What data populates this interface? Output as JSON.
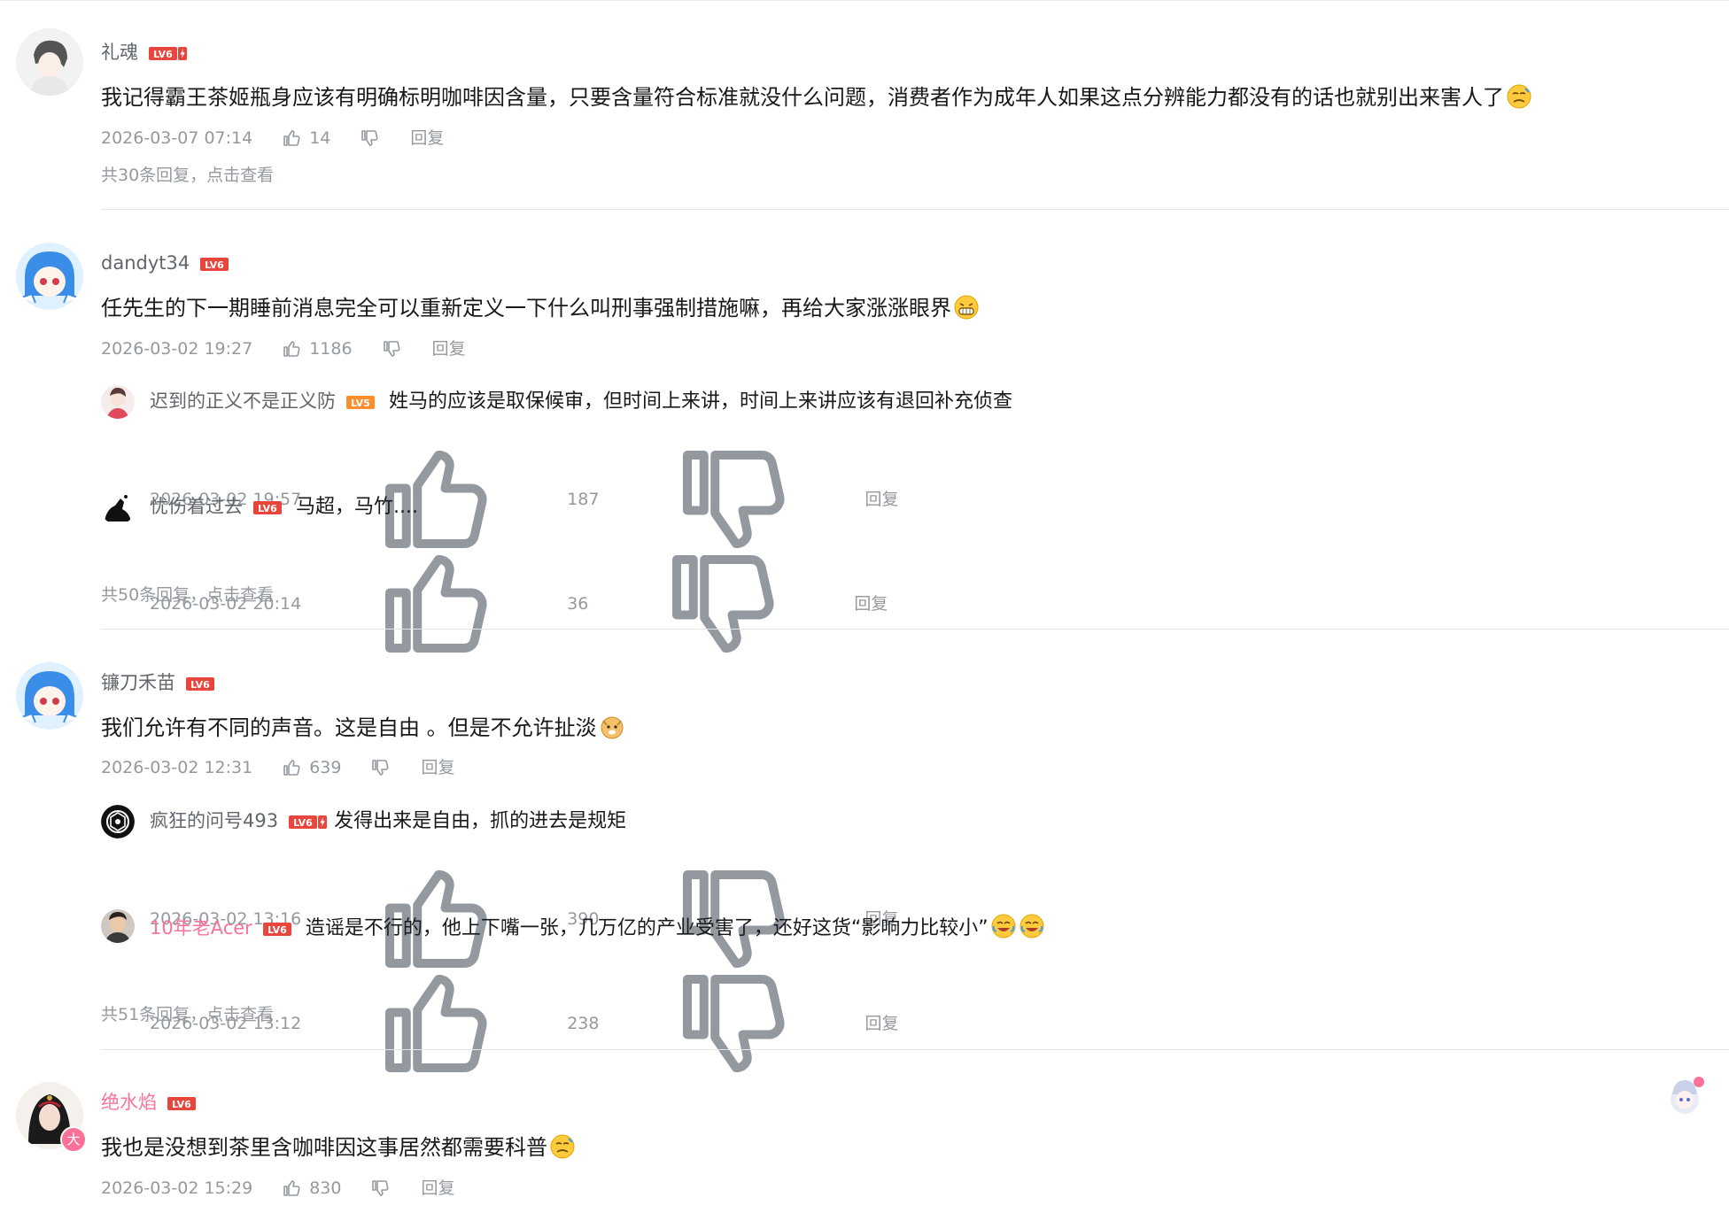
{
  "ui": {
    "colors": {
      "text": "#18191c",
      "secondary": "#61666d",
      "meta": "#9499a0",
      "vip_pink": "#fb7299",
      "level_red": "#e8453c",
      "divider": "#e3e5e7"
    },
    "icons": [
      "thumb-up-icon",
      "thumb-down-icon",
      "level-badge-icon",
      "emoji-icon"
    ]
  },
  "comments": [
    {
      "user": "礼魂",
      "level": "LV6",
      "text": "我记得霸王茶姬瓶身应该有明确标明咖啡因含量，只要含量符合标准就没什么问题，消费者作为成年人如果这点分辨能力都没有的话也就别出来害人了",
      "time": "2026-03-07 07:14",
      "likes": "14",
      "reply_label": "回复",
      "more": "共30条回复，点击查看"
    },
    {
      "user": "dandyt34",
      "level": "LV6",
      "text": "任先生的下一期睡前消息完全可以重新定义一下什么叫刑事强制措施嘛，再给大家涨涨眼界",
      "time": "2026-03-02 19:27",
      "likes": "1186",
      "reply_label": "回复",
      "replies": [
        {
          "user": "迟到的正义不是正义防",
          "level": "LV5",
          "text": "姓马的应该是取保候审，但时间上来讲，时间上来讲应该有退回补充侦查",
          "time": "2026-03-02 19:57",
          "likes": "187",
          "reply_label": "回复"
        },
        {
          "user": "忧伤着过去",
          "level": "LV6",
          "text": "马超，马竹....",
          "time": "2026-03-02 20:14",
          "likes": "36",
          "reply_label": "回复"
        }
      ],
      "more": "共50条回复，点击查看"
    },
    {
      "user": "镰刀禾苗",
      "level": "LV6",
      "text": "我们允许有不同的声音。这是自由 。但是不允许扯淡",
      "time": "2026-03-02 12:31",
      "likes": "639",
      "reply_label": "回复",
      "replies": [
        {
          "user": "疯狂的问号493",
          "level": "LV6",
          "text": "发得出来是自由，抓的进去是规矩",
          "time": "2026-03-02 13:16",
          "likes": "390",
          "reply_label": "回复"
        },
        {
          "user": "10年老Acer",
          "level": "LV6",
          "text": "造谣是不行的，他上下嘴一张，几万亿的产业受害了，还好这货“影响力比较小”",
          "time": "2026-03-02 13:12",
          "likes": "238",
          "reply_label": "回复"
        }
      ],
      "more": "共51条回复，点击查看"
    },
    {
      "user": "绝水焰",
      "level": "LV6",
      "text": "我也是没想到茶里含咖啡因这事居然都需要科普",
      "time": "2026-03-02 15:29",
      "likes": "830",
      "reply_label": "回复"
    }
  ]
}
